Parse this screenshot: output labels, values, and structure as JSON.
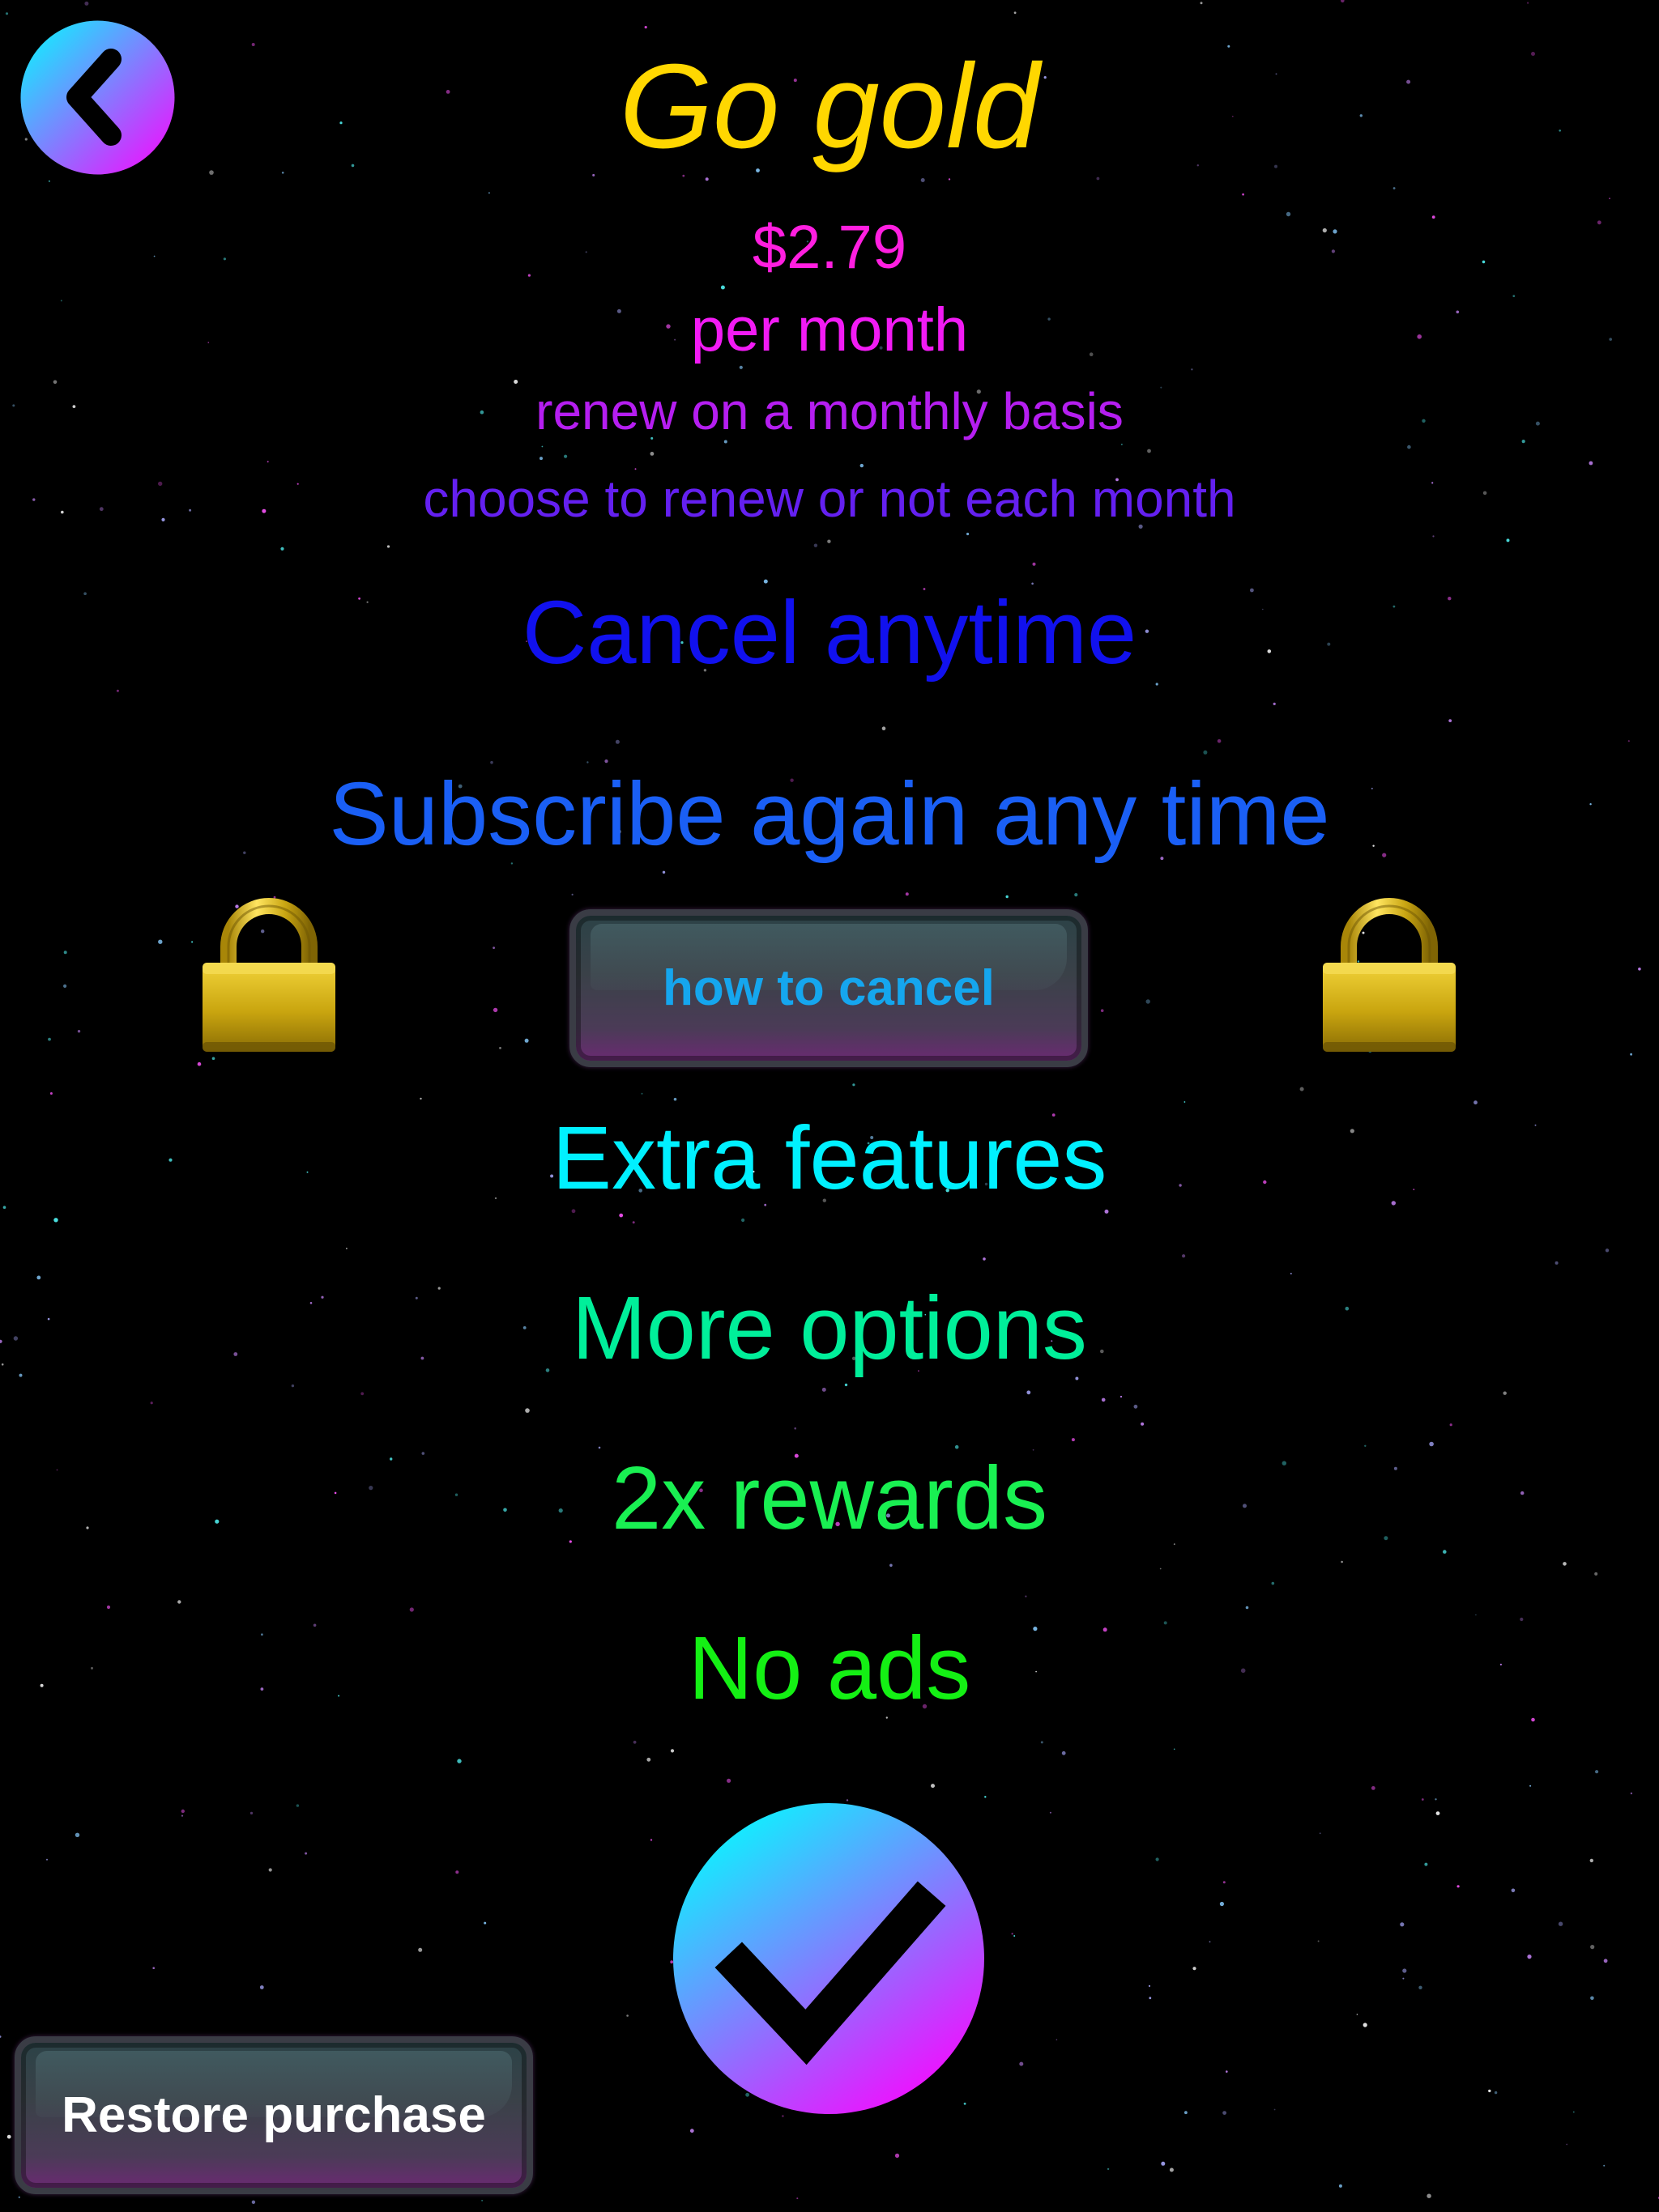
{
  "header": {
    "title": "Go gold",
    "back_icon": "chevron-left-icon"
  },
  "pricing": {
    "price": "$2.79",
    "period": "per month",
    "renew_line_1": "renew on a monthly basis",
    "renew_line_2": "choose to renew or not each month"
  },
  "messages": {
    "cancel": "Cancel anytime",
    "subscribe_again": "Subscribe again any time"
  },
  "how_to_cancel_button": {
    "label": "how to cancel"
  },
  "lock_icon": "padlock-icon",
  "features": [
    "Extra features",
    "More options",
    "2x rewards",
    "No ads"
  ],
  "confirm_button": {
    "icon": "checkmark-icon"
  },
  "restore_button": {
    "label": "Restore purchase"
  },
  "colors": {
    "background": "#000000",
    "title": "#ffd700",
    "price": "#ff1fe0",
    "period": "#f21bf4",
    "renew_1": "#b51ef0",
    "renew_2": "#6420f0",
    "cancel": "#1111ee",
    "subscribe_again": "#1a5ff5",
    "features": [
      "#00f0ff",
      "#00ef9a",
      "#19f052",
      "#14f014"
    ],
    "gradient_start": "#00ffff",
    "gradient_end": "#ff00ff",
    "how_to_cancel_text": "#15a6ee",
    "lock_gold": "#d4b21a"
  }
}
